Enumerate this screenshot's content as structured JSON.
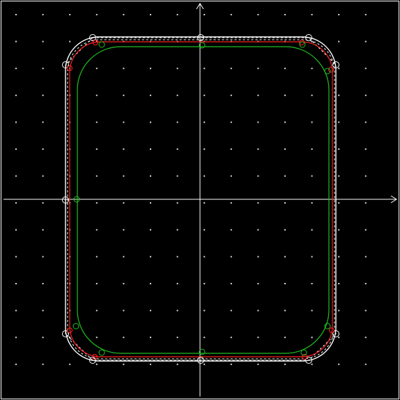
{
  "colors": {
    "background": "#000000",
    "frame": "#ffffff",
    "grid_dots": "#d9d9d9",
    "axes": "#ffffff",
    "control_polygon": "#ffffff",
    "outer_curve": "#ffffff",
    "middle_curve": "#ff2020",
    "inner_curve": "#20c020",
    "control_points": "#ffffff",
    "red_points": "#ff2020",
    "green_points": "#20c020"
  },
  "layers": {
    "frame": true,
    "grid_dots": true,
    "axes": true,
    "control_polygon": true,
    "curves": [
      "outer_curve",
      "middle_curve",
      "inner_curve"
    ],
    "point_markers": [
      "control_points",
      "red_points",
      "green_points"
    ]
  },
  "icons": {
    "axis_arrow_x": "arrow-right-icon",
    "axis_arrow_y": "arrow-up-icon",
    "point_marker": "hollow-circle-icon"
  }
}
